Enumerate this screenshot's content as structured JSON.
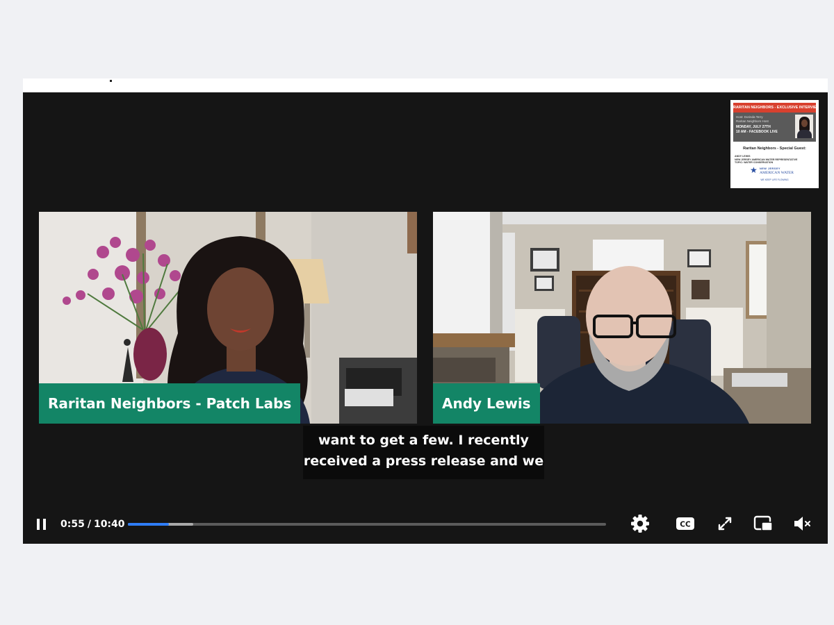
{
  "poster": {
    "header": "RARITAN NEIGHBORS - EXCLUSIVE INTERVIEW",
    "host_line1": "Host: Dorinda Terry",
    "host_line2": "Raritan Neighbors Host",
    "date": "MONDAY, JULY 27TH",
    "time": "10 AM - FACEBOOK LIVE",
    "special_guest": "Raritan Neighbors - Special Guest:",
    "guest_name": "ANDY LEWIS",
    "guest_role": "NEW JERSEY AMERICAN WATER REPRESENTATIVE",
    "topic": "TOPIC: WATER CONSERVATION",
    "logo_line1": "NEW JERSEY",
    "logo_line2": "AMERICAN WATER",
    "tagline": "WE KEEP LIFE FLOWING"
  },
  "participants": [
    {
      "name": "Raritan Neighbors - Patch Labs"
    },
    {
      "name": "Andy Lewis"
    }
  ],
  "caption": {
    "line1": "want to get a few. I recently",
    "line2": "received a press release and we"
  },
  "player": {
    "current_time": "0:55",
    "separator": "/",
    "duration": "10:40",
    "played_fraction": 0.086,
    "buffered_fraction": 0.136,
    "accent_color": "#2f7df6",
    "nametag_color": "#138566",
    "controls": [
      "pause-icon",
      "settings-icon",
      "closed-captions-icon",
      "fullscreen-icon",
      "picture-in-picture-icon",
      "muted-volume-icon"
    ]
  }
}
